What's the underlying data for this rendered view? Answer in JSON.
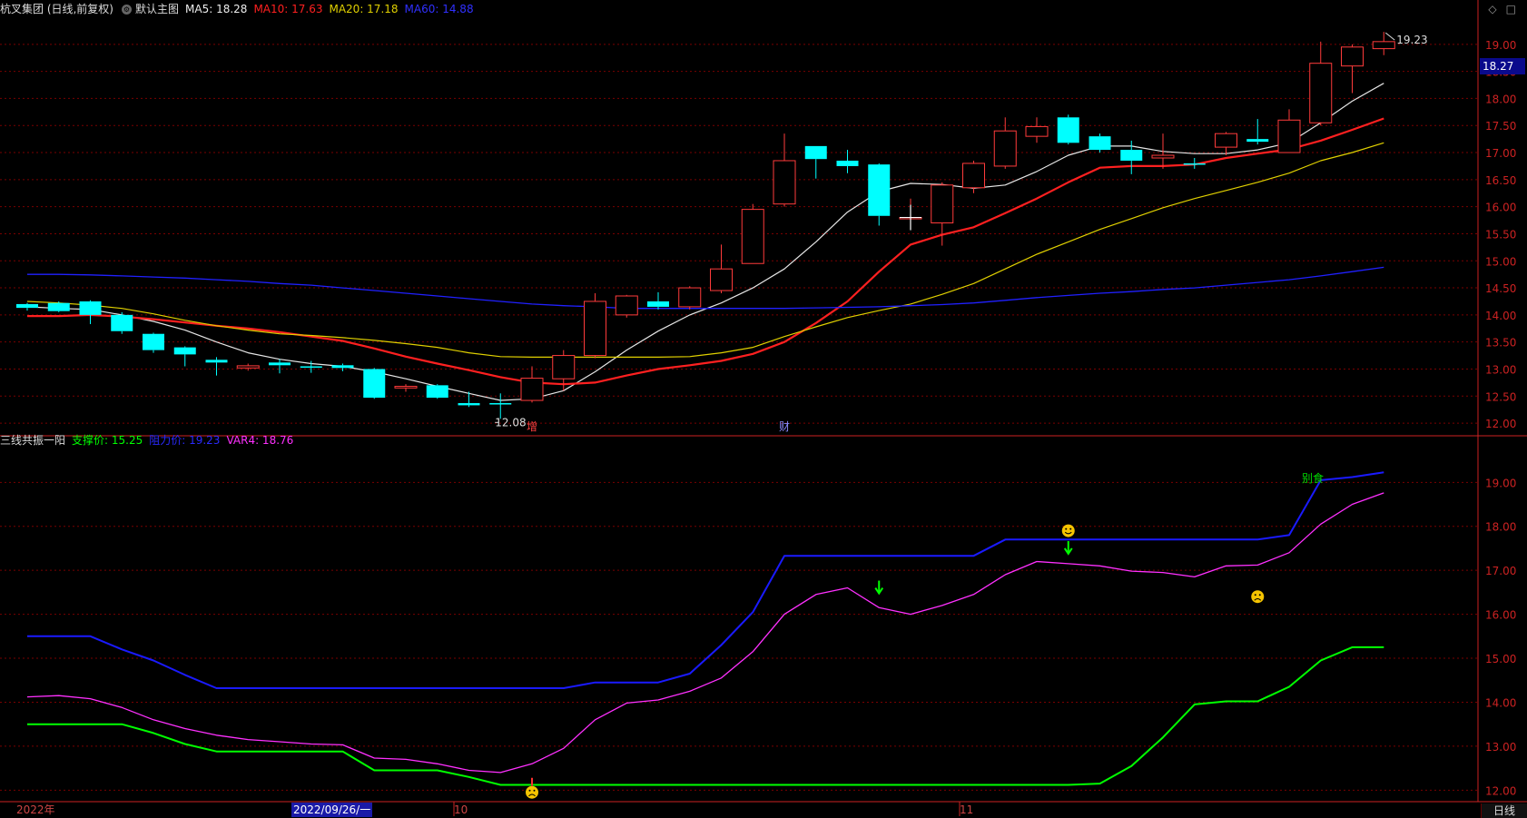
{
  "main_legend": {
    "stock": "杭叉集团 (日线,前复权)",
    "template": "默认主图",
    "ma5": "MA5: 18.28",
    "ma10": "MA10: 17.63",
    "ma20": "MA20: 17.18",
    "ma60": "MA60: 14.88"
  },
  "sub_legend": {
    "indicator": "三线共振一阳",
    "support": "支撑价: 15.25",
    "resist": "阻力价: 19.23",
    "var4": "VAR4: 18.76"
  },
  "current_price_tag": "18.27",
  "period": "日线",
  "date_highlight": "2022/09/26/一",
  "x_labels": {
    "year": "2022年",
    "oct": "10",
    "nov": "11"
  },
  "annotations": {
    "high": "19.23",
    "low": "12.08",
    "zeng": "增",
    "cai": "财",
    "bieshi": "别食"
  },
  "colors": {
    "up": "#ff3b3b",
    "down": "#00ffff",
    "ma5": "#e6e6e6",
    "ma10": "#ff2020",
    "ma20": "#e0d000",
    "ma60": "#2020ff",
    "support": "#00ff00",
    "resist": "#1a1aff",
    "var4": "#ff30ff",
    "grid": "#7a0000",
    "axis": "#cc2222"
  },
  "chart_data": [
    {
      "type": "candlestick",
      "title": "杭叉集团 (日线,前复权)",
      "y_ticks": [
        12.0,
        12.5,
        13.0,
        13.5,
        14.0,
        14.5,
        15.0,
        15.5,
        16.0,
        16.5,
        17.0,
        17.5,
        18.0,
        18.5,
        19.0
      ],
      "ylim": [
        11.8,
        19.45
      ],
      "candles": [
        {
          "o": 14.2,
          "h": 14.22,
          "l": 14.08,
          "c": 14.13
        },
        {
          "o": 14.22,
          "h": 14.25,
          "l": 14.05,
          "c": 14.07
        },
        {
          "o": 14.25,
          "h": 14.27,
          "l": 13.83,
          "c": 14.0
        },
        {
          "o": 14.0,
          "h": 14.05,
          "l": 13.65,
          "c": 13.7
        },
        {
          "o": 13.65,
          "h": 13.67,
          "l": 13.3,
          "c": 13.35
        },
        {
          "o": 13.4,
          "h": 13.42,
          "l": 13.05,
          "c": 13.27
        },
        {
          "o": 13.17,
          "h": 13.22,
          "l": 12.88,
          "c": 13.12
        },
        {
          "o": 13.02,
          "h": 13.1,
          "l": 12.97,
          "c": 13.06
        },
        {
          "o": 13.12,
          "h": 13.18,
          "l": 12.92,
          "c": 13.07
        },
        {
          "o": 13.05,
          "h": 13.15,
          "l": 12.93,
          "c": 13.03
        },
        {
          "o": 13.07,
          "h": 13.1,
          "l": 12.96,
          "c": 13.02
        },
        {
          "o": 13.0,
          "h": 13.02,
          "l": 12.45,
          "c": 12.47
        },
        {
          "o": 12.65,
          "h": 12.72,
          "l": 12.58,
          "c": 12.68
        },
        {
          "o": 12.7,
          "h": 12.72,
          "l": 12.45,
          "c": 12.47
        },
        {
          "o": 12.37,
          "h": 12.58,
          "l": 12.3,
          "c": 12.33
        },
        {
          "o": 12.37,
          "h": 12.55,
          "l": 12.08,
          "c": 12.35
        },
        {
          "o": 12.42,
          "h": 13.05,
          "l": 12.38,
          "c": 12.83
        },
        {
          "o": 12.82,
          "h": 13.35,
          "l": 12.6,
          "c": 13.25
        },
        {
          "o": 13.25,
          "h": 14.4,
          "l": 13.2,
          "c": 14.25
        },
        {
          "o": 14.0,
          "h": 14.37,
          "l": 13.95,
          "c": 14.35
        },
        {
          "o": 14.25,
          "h": 14.42,
          "l": 14.1,
          "c": 14.15
        },
        {
          "o": 14.15,
          "h": 14.53,
          "l": 14.1,
          "c": 14.5
        },
        {
          "o": 14.45,
          "h": 15.3,
          "l": 14.4,
          "c": 14.85
        },
        {
          "o": 14.95,
          "h": 16.05,
          "l": 14.95,
          "c": 15.95
        },
        {
          "o": 16.05,
          "h": 17.35,
          "l": 16.0,
          "c": 16.85
        },
        {
          "o": 17.12,
          "h": 17.12,
          "l": 16.52,
          "c": 16.88
        },
        {
          "o": 16.85,
          "h": 17.05,
          "l": 16.62,
          "c": 16.75
        },
        {
          "o": 16.78,
          "h": 16.8,
          "l": 15.65,
          "c": 15.83
        },
        {
          "o": 15.8,
          "h": 16.15,
          "l": 15.75,
          "c": 15.8
        },
        {
          "o": 15.7,
          "h": 16.45,
          "l": 15.28,
          "c": 16.4
        },
        {
          "o": 16.35,
          "h": 16.85,
          "l": 16.25,
          "c": 16.8
        },
        {
          "o": 16.75,
          "h": 17.65,
          "l": 16.7,
          "c": 17.4
        },
        {
          "o": 17.3,
          "h": 17.65,
          "l": 17.18,
          "c": 17.48
        },
        {
          "o": 17.65,
          "h": 17.7,
          "l": 17.15,
          "c": 17.18
        },
        {
          "o": 17.3,
          "h": 17.35,
          "l": 17.0,
          "c": 17.05
        },
        {
          "o": 17.05,
          "h": 17.22,
          "l": 16.6,
          "c": 16.85
        },
        {
          "o": 16.9,
          "h": 17.35,
          "l": 16.7,
          "c": 16.95
        },
        {
          "o": 16.8,
          "h": 16.9,
          "l": 16.7,
          "c": 16.78
        },
        {
          "o": 17.1,
          "h": 17.38,
          "l": 16.95,
          "c": 17.35
        },
        {
          "o": 17.25,
          "h": 17.62,
          "l": 17.15,
          "c": 17.2
        },
        {
          "o": 17.0,
          "h": 17.8,
          "l": 17.0,
          "c": 17.6
        },
        {
          "o": 17.55,
          "h": 19.05,
          "l": 17.5,
          "c": 18.65
        },
        {
          "o": 18.6,
          "h": 19.0,
          "l": 18.1,
          "c": 18.95
        },
        {
          "o": 18.92,
          "h": 19.23,
          "l": 18.8,
          "c": 19.05
        }
      ],
      "series": [
        {
          "name": "MA5",
          "values": [
            14.15,
            14.12,
            14.1,
            14.0,
            13.88,
            13.72,
            13.5,
            13.3,
            13.18,
            13.1,
            13.05,
            12.95,
            12.82,
            12.68,
            12.55,
            12.42,
            12.45,
            12.6,
            12.95,
            13.35,
            13.7,
            14.0,
            14.22,
            14.5,
            14.85,
            15.35,
            15.9,
            16.28,
            16.43,
            16.41,
            16.34,
            16.4,
            16.65,
            16.95,
            17.12,
            17.12,
            17.02,
            16.98,
            16.98,
            17.05,
            17.18,
            17.55,
            17.95,
            18.28
          ]
        },
        {
          "name": "MA10",
          "values": [
            13.98,
            13.98,
            14.0,
            13.97,
            13.92,
            13.86,
            13.8,
            13.75,
            13.68,
            13.6,
            13.52,
            13.38,
            13.23,
            13.1,
            12.98,
            12.85,
            12.75,
            12.72,
            12.75,
            12.88,
            13.0,
            13.07,
            13.15,
            13.28,
            13.5,
            13.85,
            14.25,
            14.8,
            15.3,
            15.48,
            15.62,
            15.88,
            16.15,
            16.45,
            16.72,
            16.75,
            16.75,
            16.78,
            16.9,
            16.98,
            17.06,
            17.22,
            17.42,
            17.63
          ]
        },
        {
          "name": "MA20",
          "values": [
            14.25,
            14.22,
            14.18,
            14.12,
            14.02,
            13.9,
            13.8,
            13.72,
            13.65,
            13.62,
            13.58,
            13.53,
            13.47,
            13.4,
            13.3,
            13.23,
            13.22,
            13.22,
            13.22,
            13.22,
            13.22,
            13.23,
            13.3,
            13.4,
            13.6,
            13.78,
            13.95,
            14.08,
            14.2,
            14.38,
            14.58,
            14.85,
            15.12,
            15.35,
            15.58,
            15.78,
            15.98,
            16.15,
            16.3,
            16.45,
            16.62,
            16.85,
            17.0,
            17.18
          ]
        },
        {
          "name": "MA60",
          "values": [
            14.75,
            14.75,
            14.74,
            14.72,
            14.7,
            14.68,
            14.65,
            14.62,
            14.58,
            14.55,
            14.5,
            14.45,
            14.4,
            14.35,
            14.3,
            14.25,
            14.2,
            14.17,
            14.15,
            14.12,
            14.12,
            14.12,
            14.12,
            14.12,
            14.12,
            14.13,
            14.14,
            14.15,
            14.17,
            14.19,
            14.22,
            14.27,
            14.32,
            14.36,
            14.4,
            14.43,
            14.47,
            14.5,
            14.55,
            14.6,
            14.65,
            14.72,
            14.8,
            14.88
          ]
        }
      ]
    },
    {
      "type": "line",
      "title": "三线共振一阳",
      "y_ticks": [
        12.0,
        13.0,
        14.0,
        15.0,
        16.0,
        17.0,
        18.0,
        19.0
      ],
      "ylim": [
        11.8,
        19.75
      ],
      "series": [
        {
          "name": "支撑价",
          "values": [
            13.5,
            13.5,
            13.5,
            13.5,
            13.3,
            13.05,
            12.88,
            12.88,
            12.88,
            12.88,
            12.88,
            12.45,
            12.45,
            12.45,
            12.3,
            12.12,
            12.12,
            12.12,
            12.12,
            12.12,
            12.12,
            12.12,
            12.12,
            12.12,
            12.12,
            12.12,
            12.12,
            12.12,
            12.12,
            12.12,
            12.12,
            12.12,
            12.12,
            12.12,
            12.15,
            12.55,
            13.2,
            13.95,
            14.02,
            14.02,
            14.35,
            14.95,
            15.25,
            15.25
          ]
        },
        {
          "name": "阻力价",
          "values": [
            15.5,
            15.5,
            15.5,
            15.2,
            14.95,
            14.62,
            14.32,
            14.32,
            14.32,
            14.32,
            14.32,
            14.32,
            14.32,
            14.32,
            14.32,
            14.32,
            14.32,
            14.32,
            14.45,
            14.45,
            14.45,
            14.65,
            15.3,
            16.05,
            17.33,
            17.33,
            17.33,
            17.33,
            17.33,
            17.33,
            17.33,
            17.7,
            17.7,
            17.7,
            17.7,
            17.7,
            17.7,
            17.7,
            17.7,
            17.7,
            17.8,
            19.05,
            19.12,
            19.23
          ]
        },
        {
          "name": "VAR4",
          "values": [
            14.12,
            14.15,
            14.08,
            13.88,
            13.6,
            13.4,
            13.25,
            13.15,
            13.1,
            13.05,
            13.03,
            12.73,
            12.7,
            12.6,
            12.45,
            12.4,
            12.6,
            12.95,
            13.6,
            13.98,
            14.05,
            14.25,
            14.55,
            15.15,
            16.0,
            16.45,
            16.6,
            16.15,
            16.0,
            16.2,
            16.45,
            16.9,
            17.2,
            17.15,
            17.1,
            16.98,
            16.95,
            16.85,
            17.1,
            17.12,
            17.4,
            18.05,
            18.5,
            18.76
          ]
        }
      ],
      "markers": [
        {
          "type": "arrow-down",
          "i": 27,
          "y": 16.6
        },
        {
          "type": "arrow-down",
          "i": 33,
          "y": 17.5
        },
        {
          "type": "smile",
          "i": 33,
          "y": 17.9
        },
        {
          "type": "frown",
          "i": 39,
          "y": 16.4
        },
        {
          "type": "frown",
          "i": 16,
          "y": 11.95
        }
      ]
    }
  ]
}
